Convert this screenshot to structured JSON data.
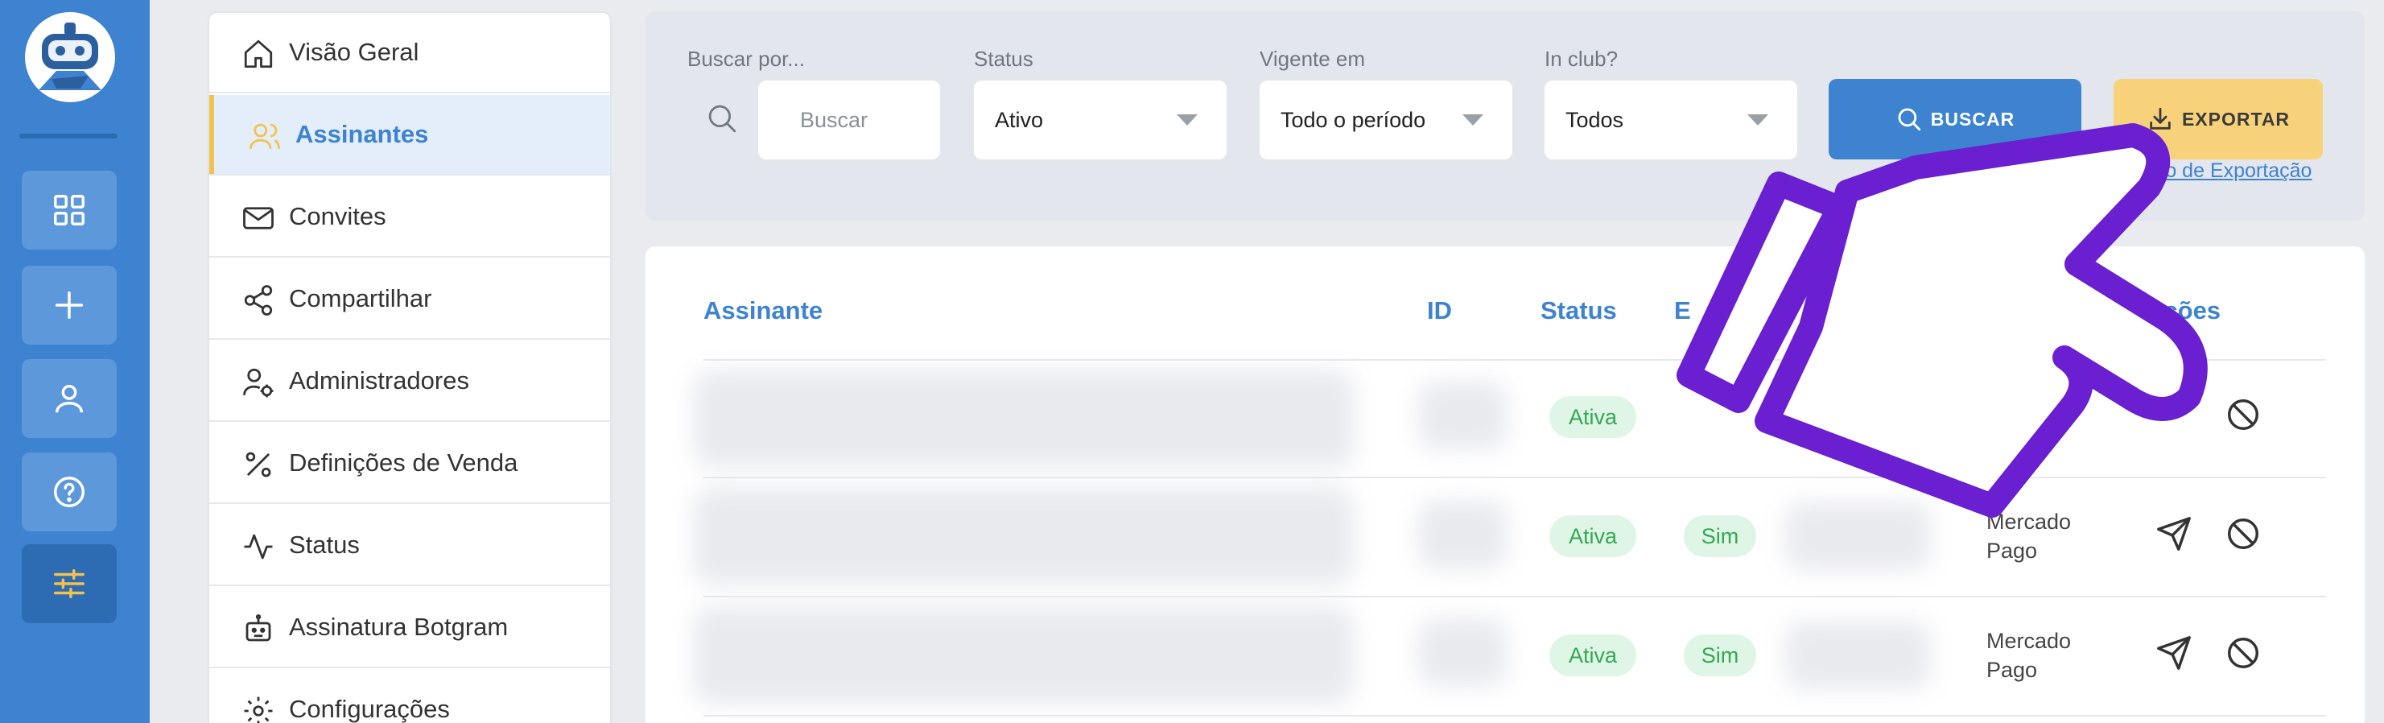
{
  "sidebar_rail": {
    "items": [
      {
        "icon": "grid-icon"
      },
      {
        "icon": "plus-icon"
      },
      {
        "icon": "user-icon"
      },
      {
        "icon": "help-icon"
      },
      {
        "icon": "sliders-icon",
        "active": true
      }
    ]
  },
  "menu": {
    "items": [
      {
        "label": "Visão Geral",
        "icon": "home-icon"
      },
      {
        "label": "Assinantes",
        "icon": "users-icon",
        "active": true
      },
      {
        "label": "Convites",
        "icon": "mail-icon"
      },
      {
        "label": "Compartilhar",
        "icon": "share-icon"
      },
      {
        "label": "Administradores",
        "icon": "admin-icon"
      },
      {
        "label": "Definições de Venda",
        "icon": "percent-icon"
      },
      {
        "label": "Status",
        "icon": "activity-icon"
      },
      {
        "label": "Assinatura Botgram",
        "icon": "bot-icon"
      },
      {
        "label": "Configurações",
        "icon": "settings-icon"
      }
    ]
  },
  "filters": {
    "search_label": "Buscar por...",
    "search_placeholder": "Buscar",
    "status_label": "Status",
    "status_value": "Ativo",
    "vigente_label": "Vigente em",
    "vigente_value": "Todo o período",
    "club_label": "In club?",
    "club_value": "Todos",
    "search_button": "BUSCAR",
    "export_button": "EXPORTAR",
    "history_link": "Histórico de Exportação"
  },
  "table": {
    "headers": {
      "assinante": "Assinante",
      "id": "ID",
      "status": "Status",
      "e": "E",
      "acoes": "Ações"
    },
    "rows": [
      {
        "status": "Ativa",
        "in_club": "",
        "gateway": ""
      },
      {
        "status": "Ativa",
        "in_club": "Sim",
        "gateway": "Mercado Pago"
      },
      {
        "status": "Ativa",
        "in_club": "Sim",
        "gateway": "Mercado Pago"
      }
    ]
  },
  "colors": {
    "rail": "#3d83cf",
    "accent": "#3d83cf",
    "export": "#f8d27a",
    "pointer": "#6a1fd0",
    "pill_bg": "#dff6e6",
    "pill_text": "#34a853"
  }
}
